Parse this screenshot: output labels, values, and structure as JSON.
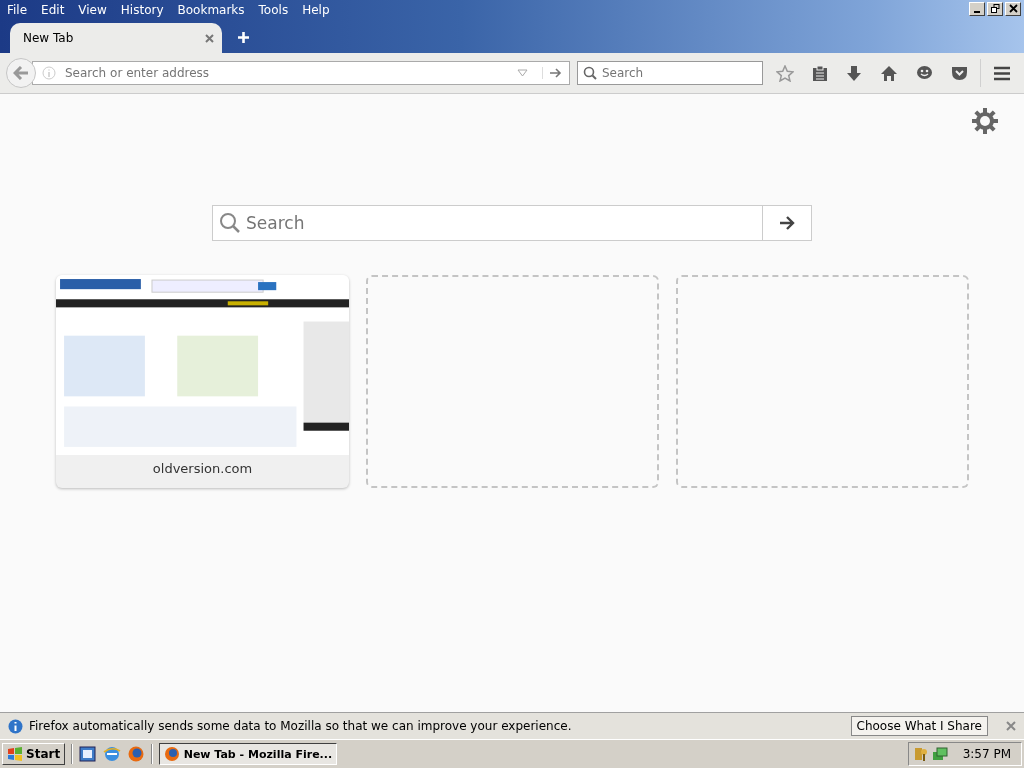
{
  "menu": [
    "File",
    "Edit",
    "View",
    "History",
    "Bookmarks",
    "Tools",
    "Help"
  ],
  "tabs": [
    {
      "label": "New Tab",
      "selected": true
    }
  ],
  "address": {
    "placeholder": "Search or enter address"
  },
  "search": {
    "placeholder": "Search"
  },
  "page_search": {
    "placeholder": "Search"
  },
  "tiles": [
    {
      "kind": "site",
      "title": "oldversion.com"
    },
    {
      "kind": "empty"
    },
    {
      "kind": "empty"
    }
  ],
  "notification": {
    "message": "Firefox automatically sends some data to Mozilla so that we can improve your experience.",
    "button": "Choose What I Share"
  },
  "taskbar": {
    "start": "Start",
    "windows": [
      {
        "label": "New Tab - Mozilla Fire...",
        "selected": true
      }
    ],
    "clock": "3:57 PM"
  }
}
